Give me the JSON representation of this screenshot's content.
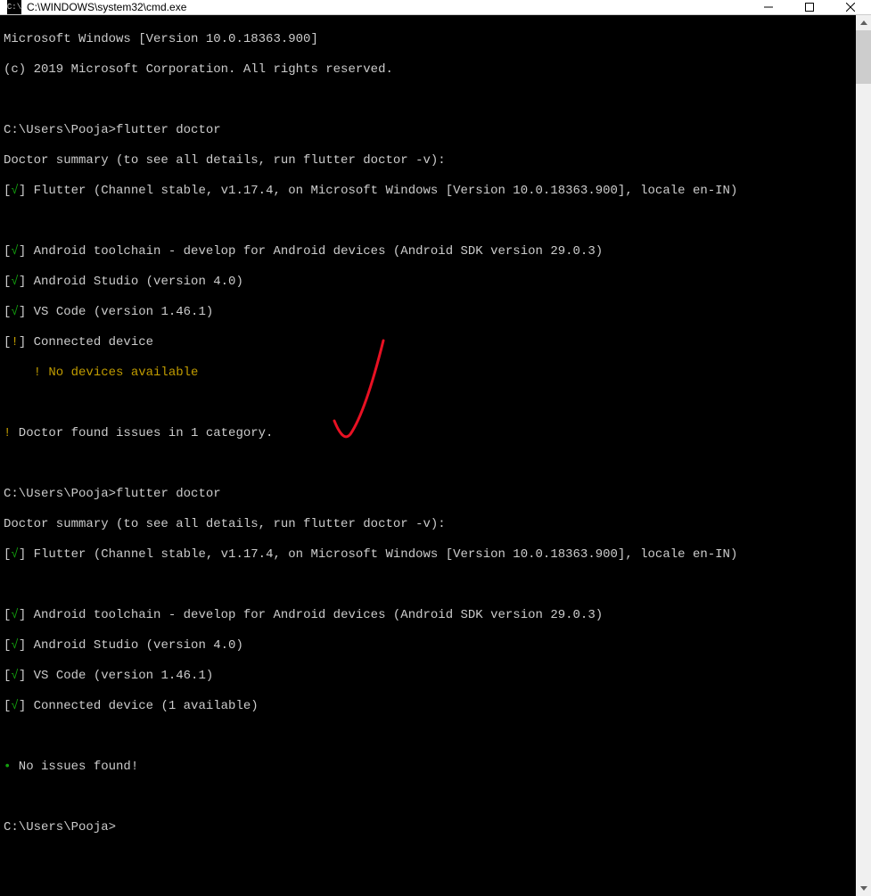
{
  "titlebar": {
    "icon_text": "C:\\",
    "title": "C:\\WINDOWS\\system32\\cmd.exe"
  },
  "header": {
    "line1": "Microsoft Windows [Version 10.0.18363.900]",
    "line2": "(c) 2019 Microsoft Corporation. All rights reserved."
  },
  "run1": {
    "prompt": "C:\\Users\\Pooja>",
    "command": "flutter doctor",
    "summary": "Doctor summary (to see all details, run flutter doctor -v):",
    "flutter_status": "[√]",
    "flutter_text": " Flutter (Channel stable, v1.17.4, on Microsoft Windows [Version 10.0.18363.900], locale en-IN)",
    "android_status": "[√]",
    "android_text": " Android toolchain - develop for Android devices (Android SDK version 29.0.3)",
    "studio_status": "[√]",
    "studio_text": " Android Studio (version 4.0)",
    "vscode_status": "[√]",
    "vscode_text": " VS Code (version 1.46.1)",
    "device_status": "[!]",
    "device_text": " Connected device",
    "device_sub": "    ! No devices available",
    "issues_bullet": "!",
    "issues_text": " Doctor found issues in 1 category."
  },
  "run2": {
    "prompt": "C:\\Users\\Pooja>",
    "command": "flutter doctor",
    "summary": "Doctor summary (to see all details, run flutter doctor -v):",
    "flutter_status": "[√]",
    "flutter_text": " Flutter (Channel stable, v1.17.4, on Microsoft Windows [Version 10.0.18363.900], locale en-IN)",
    "android_status": "[√]",
    "android_text": " Android toolchain - develop for Android devices (Android SDK version 29.0.3)",
    "studio_status": "[√]",
    "studio_text": " Android Studio (version 4.0)",
    "vscode_status": "[√]",
    "vscode_text": " VS Code (version 1.46.1)",
    "device_status": "[√]",
    "device_text": " Connected device (1 available)",
    "noissues_bullet": "•",
    "noissues_text": " No issues found!"
  },
  "final_prompt": {
    "prompt": "C:\\Users\\Pooja>"
  }
}
